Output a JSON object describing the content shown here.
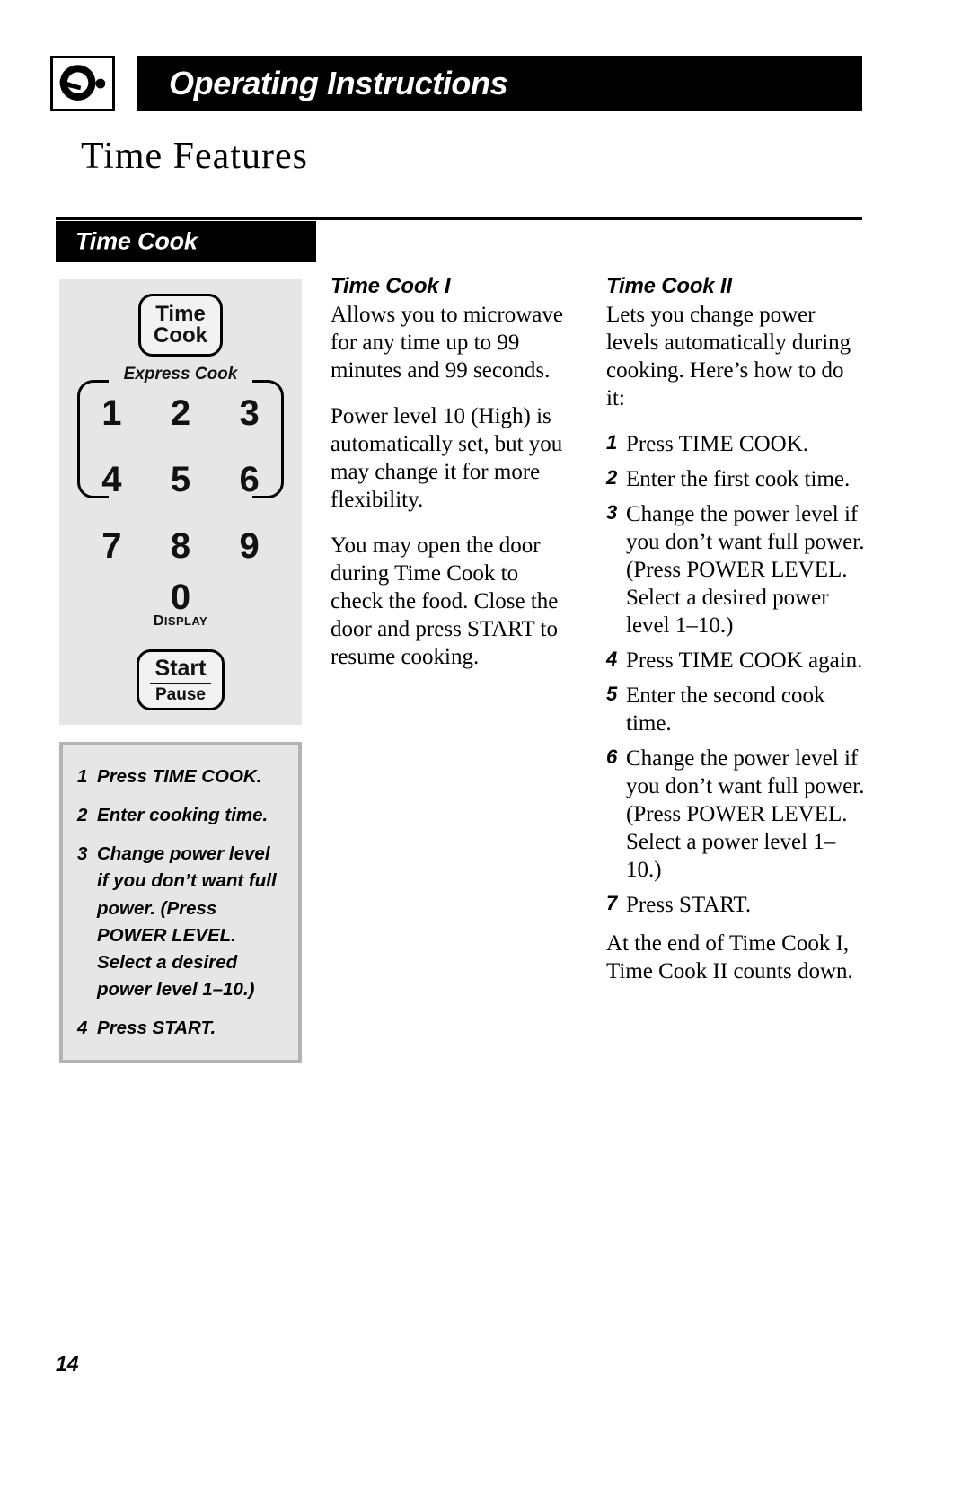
{
  "header": {
    "title": "Operating Instructions",
    "icon": "microwave-knob-icon"
  },
  "section_title": "Time Features",
  "banner": {
    "label": "Time Cook"
  },
  "control_panel": {
    "time_cook_key": {
      "line1": "Time",
      "line2": "Cook"
    },
    "express_cook_label": "Express Cook",
    "keys": [
      [
        "1",
        "2",
        "3"
      ],
      [
        "4",
        "5",
        "6"
      ],
      [
        "7",
        "8",
        "9"
      ]
    ],
    "zero_key": "0",
    "display_label": "DISPLAY",
    "display_label_first": "D",
    "display_label_rest": "ISPLAY",
    "start_key": {
      "line1": "Start",
      "line2": "Pause"
    }
  },
  "steps_box": {
    "items": [
      {
        "num": "1",
        "text": "Press TIME COOK."
      },
      {
        "num": "2",
        "text": "Enter cooking time."
      },
      {
        "num": "3",
        "text": "Change power level if you don’t want full power. (Press POWER LEVEL. Select a desired power level 1–10.)"
      },
      {
        "num": "4",
        "text": "Press START."
      }
    ]
  },
  "column_middle": {
    "heading": "Time Cook I",
    "paragraphs": [
      "Allows you to microwave for any time up to 99 minutes and 99 seconds.",
      "Power level 10 (High) is automatically set, but you may change it for more flexibility.",
      "You may open the door during Time Cook to check the food. Close the door and press START to resume cooking."
    ]
  },
  "column_right": {
    "heading": "Time Cook II",
    "intro": "Lets you change power levels automatically during cooking. Here’s how to do it:",
    "steps": [
      {
        "num": "1",
        "text": "Press TIME COOK."
      },
      {
        "num": "2",
        "text": "Enter the first cook time."
      },
      {
        "num": "3",
        "text": "Change the power level if you don’t want full power. (Press POWER LEVEL. Select a desired power level 1–10.)"
      },
      {
        "num": "4",
        "text": "Press TIME COOK again."
      },
      {
        "num": "5",
        "text": "Enter the second cook time."
      },
      {
        "num": "6",
        "text": "Change the power level if you don’t want full power. (Press POWER LEVEL. Select a power level 1–10.)"
      },
      {
        "num": "7",
        "text": "Press START."
      }
    ],
    "closing": "At the end of Time Cook I, Time Cook II counts down."
  },
  "footer": {
    "page_number": "14"
  }
}
